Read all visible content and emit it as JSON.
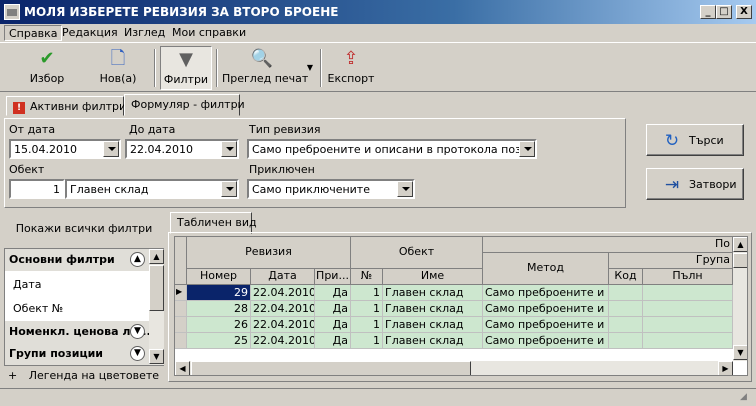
{
  "window": {
    "title": "МОЛЯ ИЗБЕРЕТЕ РЕВИЗИЯ ЗА ВТОРО БРОЕНЕ",
    "min": "_",
    "max": "□",
    "close": "X"
  },
  "menu": [
    "Справка",
    "Редакция",
    "Изглед",
    "Мои справки"
  ],
  "toolbar": {
    "select": "Избор",
    "new": "Нов(а)",
    "filters": "Филтри",
    "preview": "Преглед печат",
    "export": "Експорт"
  },
  "filter_tabs": {
    "active": "Активни филтри",
    "form": "Формуляр - филтри"
  },
  "form": {
    "from_date_label": "От дата",
    "from_date": "15.04.2010",
    "to_date_label": "До дата",
    "to_date": "22.04.2010",
    "type_label": "Тип ревизия",
    "type_value": "Само преброените и описани в протокола позиции",
    "object_label": "Обект",
    "object_num": "1",
    "object_name": "Главен склад",
    "completed_label": "Приключен",
    "completed_value": "Само приключените"
  },
  "buttons": {
    "search": "Търси",
    "close": "Затвори"
  },
  "left": {
    "show_all": "Покажи всички филтри",
    "groups": [
      {
        "label": "Основни филтри"
      },
      {
        "label": "Номенкл. ценова ли..."
      },
      {
        "label": "Групи позиции"
      }
    ],
    "items": [
      "Дата",
      "Обект №"
    ],
    "legend": "Легенда на цветовете",
    "legend_icon": "+"
  },
  "view_tab": "Табличен вид",
  "grid": {
    "group_revision": "Ревизия",
    "group_object": "Обект",
    "group_p": "По",
    "group_grupa": "Група",
    "col_number": "Номер",
    "col_date": "Дата",
    "col_pri": "При...",
    "col_no": "№",
    "col_name": "Име",
    "col_method": "Метод",
    "col_code": "Код",
    "col_pal": "Пълн",
    "rows": [
      {
        "number": "29",
        "date": "22.04.2010",
        "pri": "Да",
        "no": "1",
        "name": "Главен склад",
        "method": "Само преброените и о..."
      },
      {
        "number": "28",
        "date": "22.04.2010",
        "pri": "Да",
        "no": "1",
        "name": "Главен склад",
        "method": "Само преброените и о..."
      },
      {
        "number": "26",
        "date": "22.04.2010",
        "pri": "Да",
        "no": "1",
        "name": "Главен склад",
        "method": "Само преброените и о..."
      },
      {
        "number": "25",
        "date": "22.04.2010",
        "pri": "Да",
        "no": "1",
        "name": "Главен склад",
        "method": "Само преброените и о..."
      }
    ]
  },
  "colors": {
    "row_bg": "#cde7cf",
    "title_start": "#0a246a"
  }
}
